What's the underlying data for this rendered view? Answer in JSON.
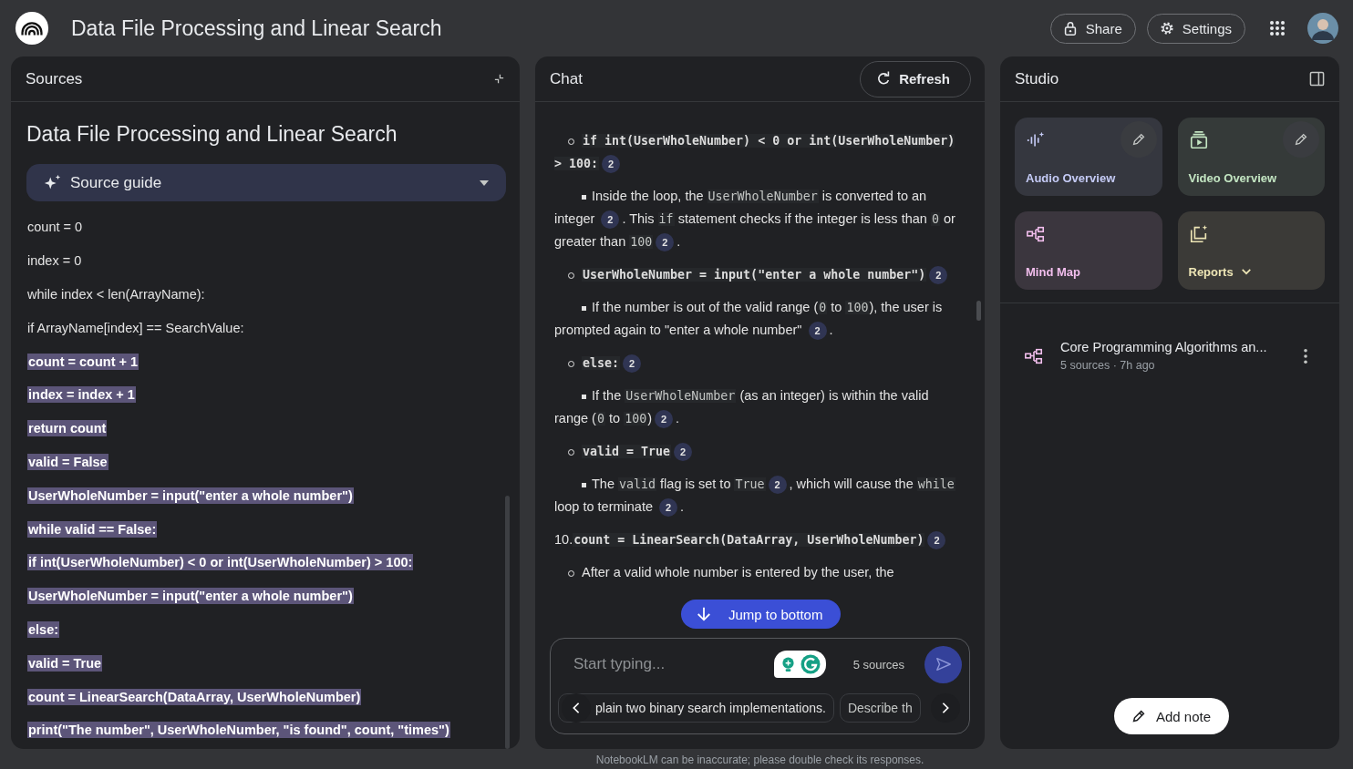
{
  "app": {
    "title": "Data File Processing and Linear Search",
    "share": "Share",
    "settings": "Settings"
  },
  "sources": {
    "header": "Sources",
    "title": "Data File Processing and Linear Search",
    "guide": {
      "label": "Source guide"
    },
    "lines": [
      {
        "text": "count = 0",
        "highlighted": false
      },
      {
        "text": "index = 0",
        "highlighted": false
      },
      {
        "text": "while index < len(ArrayName):",
        "highlighted": false
      },
      {
        "text": "if ArrayName[index] == SearchValue:",
        "highlighted": false
      },
      {
        "text": "count = count + 1",
        "highlighted": true
      },
      {
        "text": "index = index + 1",
        "highlighted": true
      },
      {
        "text": "return count",
        "highlighted": true
      },
      {
        "text": "valid = False",
        "highlighted": true
      },
      {
        "text": "UserWholeNumber = input(\"enter a whole number\")",
        "highlighted": true
      },
      {
        "text": "while valid == False:",
        "highlighted": true
      },
      {
        "text": "if int(UserWholeNumber) < 0 or int(UserWholeNumber) > 100:",
        "highlighted": true
      },
      {
        "text": "UserWholeNumber = input(\"enter a whole number\")",
        "highlighted": true
      },
      {
        "text": "else:",
        "highlighted": true
      },
      {
        "text": "valid = True",
        "highlighted": true
      },
      {
        "text": "count = LinearSearch(DataArray, UserWholeNumber)",
        "highlighted": true
      },
      {
        "text": "print(\"The number\", UserWholeNumber, \"is found\", count, \"times\")",
        "highlighted": true
      }
    ]
  },
  "chat": {
    "header": "Chat",
    "refresh": "Refresh",
    "blocks": [
      {
        "kind": "sub",
        "parts": [
          {
            "kind": "strong_code",
            "text": "if int(UserWholeNumber) < 0 or int(UserWholeNumber) > 100:"
          },
          {
            "kind": "cite",
            "text": "2"
          }
        ]
      },
      {
        "kind": "bullet",
        "parts": [
          {
            "kind": "text",
            "text": "Inside the loop, the "
          },
          {
            "kind": "code",
            "text": "UserWholeNumber"
          },
          {
            "kind": "text",
            "text": " is converted to an integer "
          },
          {
            "kind": "cite",
            "text": "2"
          },
          {
            "kind": "text",
            "text": ". This "
          },
          {
            "kind": "code",
            "text": "if"
          },
          {
            "kind": "text",
            "text": " statement checks if the integer is less than "
          },
          {
            "kind": "code",
            "text": "0"
          },
          {
            "kind": "text",
            "text": " or greater than "
          },
          {
            "kind": "code",
            "text": "100"
          },
          {
            "kind": "cite",
            "text": "2"
          },
          {
            "kind": "text",
            "text": "."
          }
        ]
      },
      {
        "kind": "sub",
        "parts": [
          {
            "kind": "strong_code",
            "text": "UserWholeNumber = input(\"enter a whole number\")"
          },
          {
            "kind": "cite",
            "text": "2"
          }
        ]
      },
      {
        "kind": "bullet",
        "parts": [
          {
            "kind": "text",
            "text": "If the number is out of the valid range ("
          },
          {
            "kind": "code",
            "text": "0"
          },
          {
            "kind": "text",
            "text": " to "
          },
          {
            "kind": "code",
            "text": "100"
          },
          {
            "kind": "text",
            "text": "), the user is prompted again to \"enter a whole number\" "
          },
          {
            "kind": "cite",
            "text": "2"
          },
          {
            "kind": "text",
            "text": "."
          }
        ]
      },
      {
        "kind": "sub",
        "parts": [
          {
            "kind": "strong_code",
            "text": "else:"
          },
          {
            "kind": "cite",
            "text": "2"
          }
        ]
      },
      {
        "kind": "bullet",
        "parts": [
          {
            "kind": "text",
            "text": "If the "
          },
          {
            "kind": "code",
            "text": "UserWholeNumber"
          },
          {
            "kind": "text",
            "text": " (as an integer) is within the valid range ("
          },
          {
            "kind": "code",
            "text": "0"
          },
          {
            "kind": "text",
            "text": " to "
          },
          {
            "kind": "code",
            "text": "100"
          },
          {
            "kind": "text",
            "text": ")"
          },
          {
            "kind": "cite",
            "text": "2"
          },
          {
            "kind": "text",
            "text": "."
          }
        ]
      },
      {
        "kind": "sub",
        "parts": [
          {
            "kind": "strong_code",
            "text": "valid = True"
          },
          {
            "kind": "cite",
            "text": "2"
          }
        ]
      },
      {
        "kind": "bullet",
        "parts": [
          {
            "kind": "text",
            "text": "The "
          },
          {
            "kind": "code",
            "text": "valid"
          },
          {
            "kind": "text",
            "text": " flag is set to "
          },
          {
            "kind": "code",
            "text": "True"
          },
          {
            "kind": "cite",
            "text": "2"
          },
          {
            "kind": "text",
            "text": ", which will cause the "
          },
          {
            "kind": "code",
            "text": "while"
          },
          {
            "kind": "text",
            "text": " loop to terminate "
          },
          {
            "kind": "cite",
            "text": "2"
          },
          {
            "kind": "text",
            "text": "."
          }
        ]
      },
      {
        "kind": "num",
        "number": "10.",
        "parts": [
          {
            "kind": "strong_code",
            "text": "count = LinearSearch(DataArray, UserWholeNumber)"
          },
          {
            "kind": "cite",
            "text": "2"
          }
        ]
      },
      {
        "kind": "sub",
        "parts": [
          {
            "kind": "text",
            "text": "After a valid whole number is entered by the user, the"
          }
        ]
      }
    ],
    "jump": "Jump to bottom",
    "placeholder": "Start typing...",
    "source_count": "5 sources",
    "suggestions": [
      "plain two binary search implementations.",
      "Describe th"
    ],
    "disclaimer": "NotebookLM can be inaccurate; please double check its responses."
  },
  "studio": {
    "header": "Studio",
    "cards": [
      {
        "kind": "audio",
        "label": "Audio Overview",
        "color": "#c5cbf6",
        "edit": true,
        "menu": false
      },
      {
        "kind": "video",
        "label": "Video Overview",
        "color": "#c3e5c2",
        "edit": true,
        "menu": false
      },
      {
        "kind": "mindmap",
        "label": "Mind Map",
        "color": "#f3bfee",
        "edit": false,
        "menu": false
      },
      {
        "kind": "reports",
        "label": "Reports",
        "color": "#ede5b5",
        "edit": false,
        "menu": true
      }
    ],
    "notes": [
      {
        "title": "Core Programming Algorithms an...",
        "meta": "5 sources · 7h ago"
      }
    ],
    "add_note": "Add note"
  }
}
